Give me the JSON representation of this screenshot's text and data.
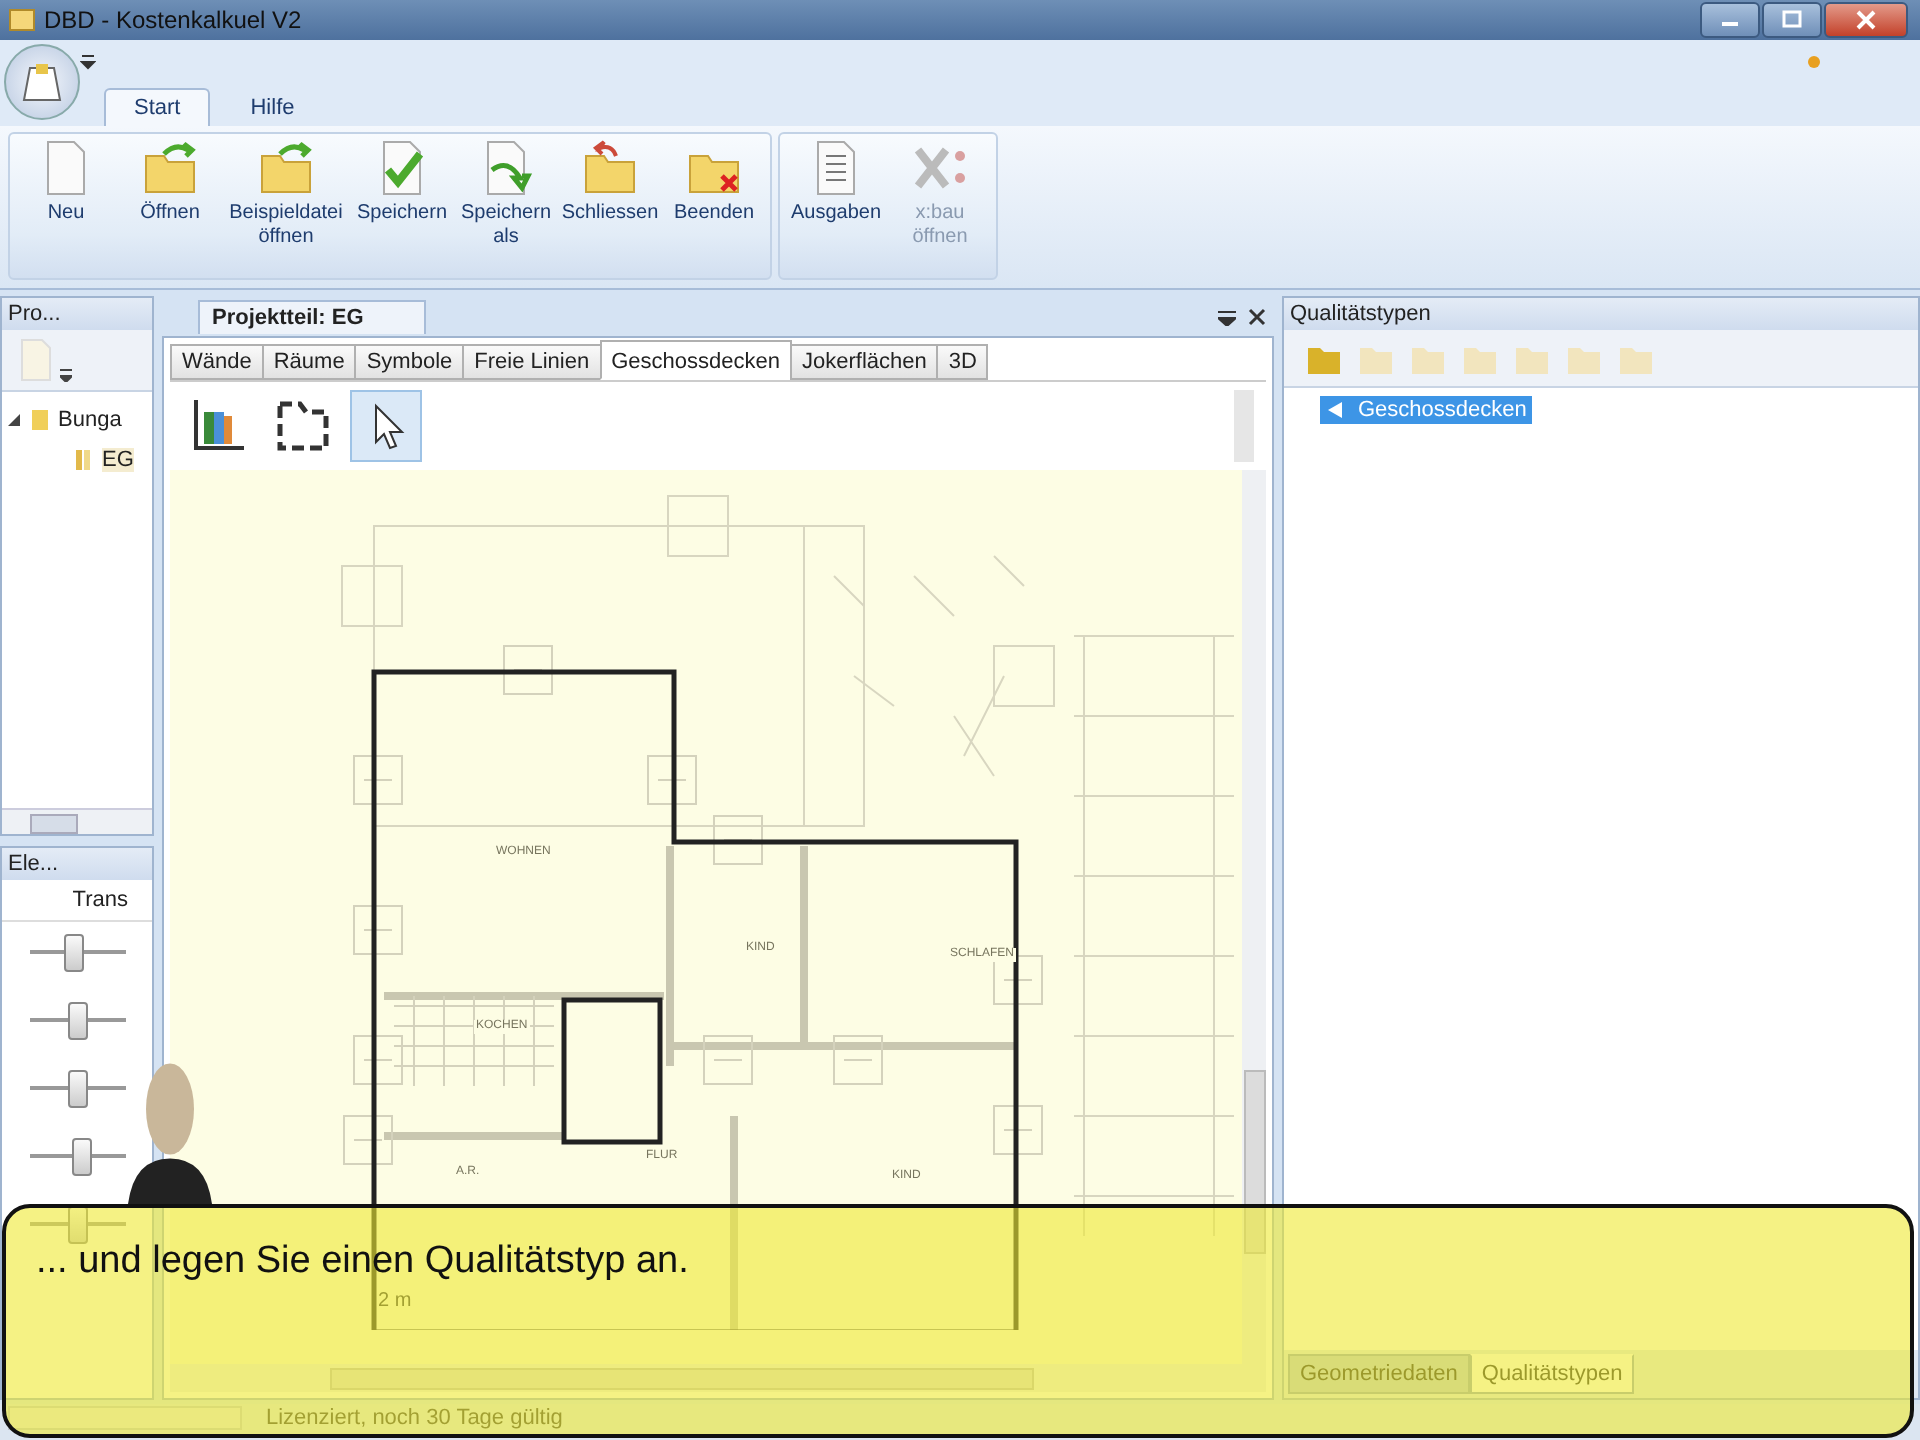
{
  "window": {
    "title": "DBD - Kostenkalkuel V2"
  },
  "ribbon_tabs": [
    {
      "label": "Start",
      "selected": true
    },
    {
      "label": "Hilfe",
      "selected": false
    }
  ],
  "ribbon_groups": [
    {
      "buttons": [
        {
          "label": "Neu",
          "disabled": false
        },
        {
          "label": "Öffnen",
          "disabled": false
        },
        {
          "label": "Beispieldatei öffnen",
          "disabled": false
        },
        {
          "label": "Speichern",
          "disabled": false
        },
        {
          "label": "Speichern als",
          "disabled": false
        },
        {
          "label": "Schliessen",
          "disabled": false
        },
        {
          "label": "Beenden",
          "disabled": false
        }
      ]
    },
    {
      "buttons": [
        {
          "label": "Ausgaben",
          "disabled": false
        },
        {
          "label": "x:bau öffnen",
          "disabled": true
        }
      ]
    }
  ],
  "project_panel": {
    "title": "Pro...",
    "tree": [
      {
        "label": "Bunga",
        "expanded": true,
        "children": [
          {
            "label": "EG"
          }
        ]
      }
    ]
  },
  "elements_panel": {
    "title": "Ele...",
    "column": "Trans",
    "sliders": [
      {
        "level": 0.45
      },
      {
        "level": 0.5
      },
      {
        "level": 0.5
      },
      {
        "level": 0.55
      },
      {
        "level": 0.5
      }
    ]
  },
  "editor": {
    "document_tab": "Projektteil: EG",
    "tabs": [
      {
        "label": "Wände",
        "selected": false
      },
      {
        "label": "Räume",
        "selected": false
      },
      {
        "label": "Symbole",
        "selected": false
      },
      {
        "label": "Freie Linien",
        "selected": false
      },
      {
        "label": "Geschossdecken",
        "selected": true
      },
      {
        "label": "Jokerflächen",
        "selected": false
      },
      {
        "label": "3D",
        "selected": false
      }
    ],
    "tools": [
      {
        "selected": false
      },
      {
        "selected": false
      },
      {
        "selected": true
      }
    ],
    "rooms": [
      "WOHNEN",
      "KIND",
      "SCHLAFEN",
      "KOCHEN",
      "A.R.",
      "FLUR",
      "KIND"
    ],
    "scale_label": "2 m"
  },
  "quality_panel": {
    "title": "Qualitätstypen",
    "tree": [
      {
        "label": "Geschossdecken",
        "selected": true
      }
    ],
    "tabs": [
      {
        "label": "Geometriedaten",
        "selected": false
      },
      {
        "label": "Qualitätstypen",
        "selected": true
      }
    ]
  },
  "status_bar": {
    "text": "Lizenziert, noch 30 Tage gültig"
  },
  "callout": {
    "text": "... und legen Sie einen Qualitätstyp an."
  }
}
